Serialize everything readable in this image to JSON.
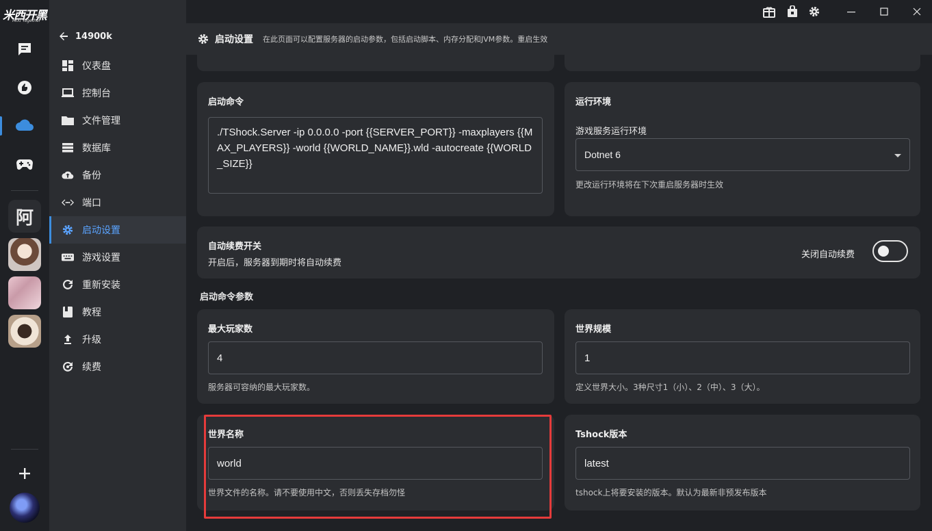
{
  "rail": {
    "logo_text": "米西开黑",
    "logo_sub": "MIXI Together",
    "avatar_a_text": "阿",
    "icons": [
      "chat-icon",
      "thumb-icon",
      "cloud-icon",
      "gamepad-icon",
      "plus-icon"
    ]
  },
  "sidebar": {
    "back_label": "14900k",
    "items": [
      {
        "label": "仪表盘",
        "icon": "dashboard-icon"
      },
      {
        "label": "控制台",
        "icon": "laptop-icon"
      },
      {
        "label": "文件管理",
        "icon": "folder-icon"
      },
      {
        "label": "数据库",
        "icon": "database-icon"
      },
      {
        "label": "备份",
        "icon": "cloud-upload-icon"
      },
      {
        "label": "端口",
        "icon": "port-icon"
      },
      {
        "label": "启动设置",
        "icon": "gear-icon",
        "active": true
      },
      {
        "label": "游戏设置",
        "icon": "keyboard-icon"
      },
      {
        "label": "重新安装",
        "icon": "refresh-icon"
      },
      {
        "label": "教程",
        "icon": "book-icon"
      },
      {
        "label": "升级",
        "icon": "upgrade-icon"
      },
      {
        "label": "续费",
        "icon": "renew-icon"
      }
    ]
  },
  "topbar": {
    "icons": [
      "gift-icon",
      "bag-icon",
      "settings-icon",
      "minimize-icon",
      "maximize-icon",
      "close-icon"
    ]
  },
  "header": {
    "title": "启动设置",
    "description": "在此页面可以配置服务器的启动参数，包括启动脚本、内存分配和JVM参数。重启生效"
  },
  "startup_command": {
    "title": "启动命令",
    "value": "./TShock.Server -ip 0.0.0.0 -port {{SERVER_PORT}} -maxplayers {{MAX_PLAYERS}} -world {{WORLD_NAME}}.wld -autocreate {{WORLD_SIZE}}"
  },
  "runtime": {
    "title": "运行环境",
    "label": "游戏服务运行环境",
    "selected": "Dotnet 6",
    "help": "更改运行环境将在下次重启服务器时生效"
  },
  "auto_renew": {
    "title": "自动续费开关",
    "desc": "开启后，服务器到期时将自动续费",
    "toggle_label": "关闭自动续费",
    "enabled": false
  },
  "params_section": {
    "title": "启动命令参数"
  },
  "params": {
    "max_players": {
      "title": "最大玩家数",
      "value": "4",
      "help": "服务器可容纳的最大玩家数。"
    },
    "world_size": {
      "title": "世界规模",
      "value": "1",
      "help": "定义世界大小。3种尺寸1（小）、2（中）、3（大）。"
    },
    "world_name": {
      "title": "世界名称",
      "value": "world",
      "help": "世界文件的名称。请不要使用中文，否则丢失存档勿怪"
    },
    "tshock_version": {
      "title": "Tshock版本",
      "value": "latest",
      "help": "tshock上将要安装的版本。默认为最新非预发布版本"
    }
  },
  "colors": {
    "accent": "#3c8dde",
    "highlight": "#e53b3b",
    "panel": "#2b2d31",
    "background": "#1f2125"
  }
}
